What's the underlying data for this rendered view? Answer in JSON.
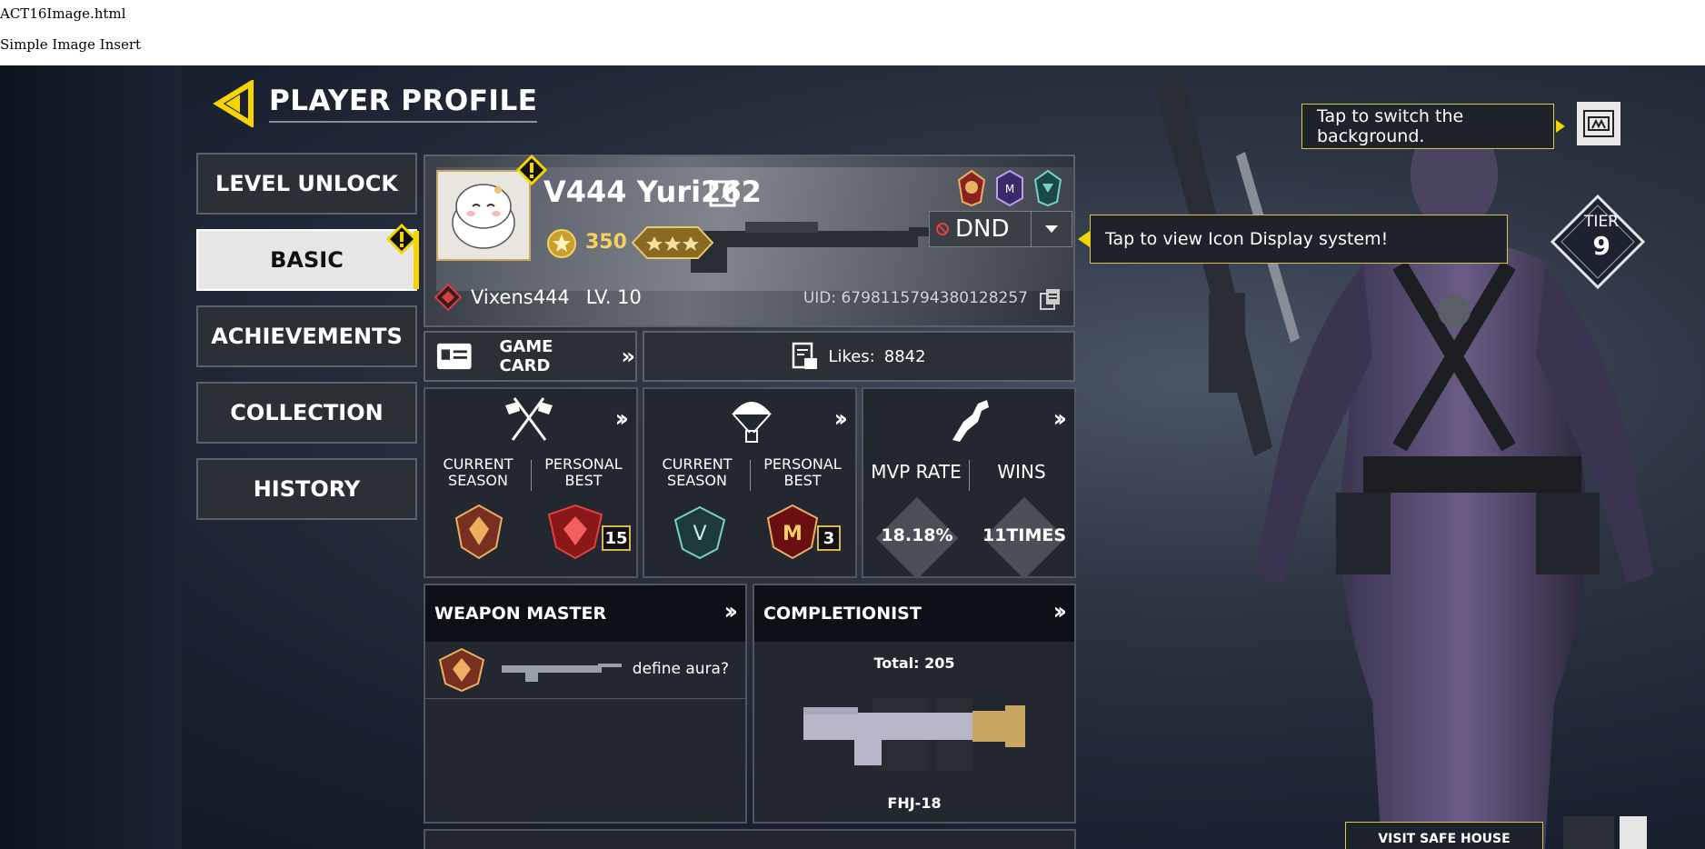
{
  "page": {
    "title": "ACT16Image.html",
    "subtitle": "Simple Image Insert"
  },
  "header": {
    "title": "PLAYER PROFILE"
  },
  "sidebar": {
    "items": [
      {
        "label": "LEVEL UNLOCK"
      },
      {
        "label": "BASIC"
      },
      {
        "label": "ACHIEVEMENTS"
      },
      {
        "label": "COLLECTION"
      },
      {
        "label": "HISTORY"
      }
    ]
  },
  "profile": {
    "name": "V444 Yuri262",
    "coins": "350",
    "status": "DND",
    "guild": "Vixens444",
    "level": "LV. 10",
    "uid": "UID: 6798115794380128257"
  },
  "tips": {
    "background": "Tap to switch the background.",
    "icon_display": "Tap to view Icon Display system!"
  },
  "game_card": {
    "label": "GAME CARD",
    "chevrons": "»"
  },
  "likes": {
    "label": "Likes:",
    "value": "8842"
  },
  "ranked_mp": {
    "col1": "CURRENT\nSEASON",
    "col2": "PERSONAL\nBEST",
    "best_count": "15"
  },
  "ranked_br": {
    "col1": "CURRENT\nSEASON",
    "col2": "PERSONAL\nBEST",
    "best_count": "3"
  },
  "stats": {
    "col1": "MVP RATE",
    "col2": "WINS",
    "mvp_rate": "18.18%",
    "wins": "11TIMES"
  },
  "weapon_master": {
    "title": "WEAPON MASTER",
    "caption": "define aura?"
  },
  "completionist": {
    "title": "COMPLETIONIST",
    "total": "Total: 205",
    "weapon": "FHJ-18"
  },
  "tier": {
    "label": "TIER",
    "value": "9"
  },
  "footer": {
    "safe_house": "VISIT SAFE HOUSE"
  },
  "colors": {
    "accent": "#f5d400",
    "tip_border": "#d9c64a",
    "coin": "#f5d060"
  }
}
